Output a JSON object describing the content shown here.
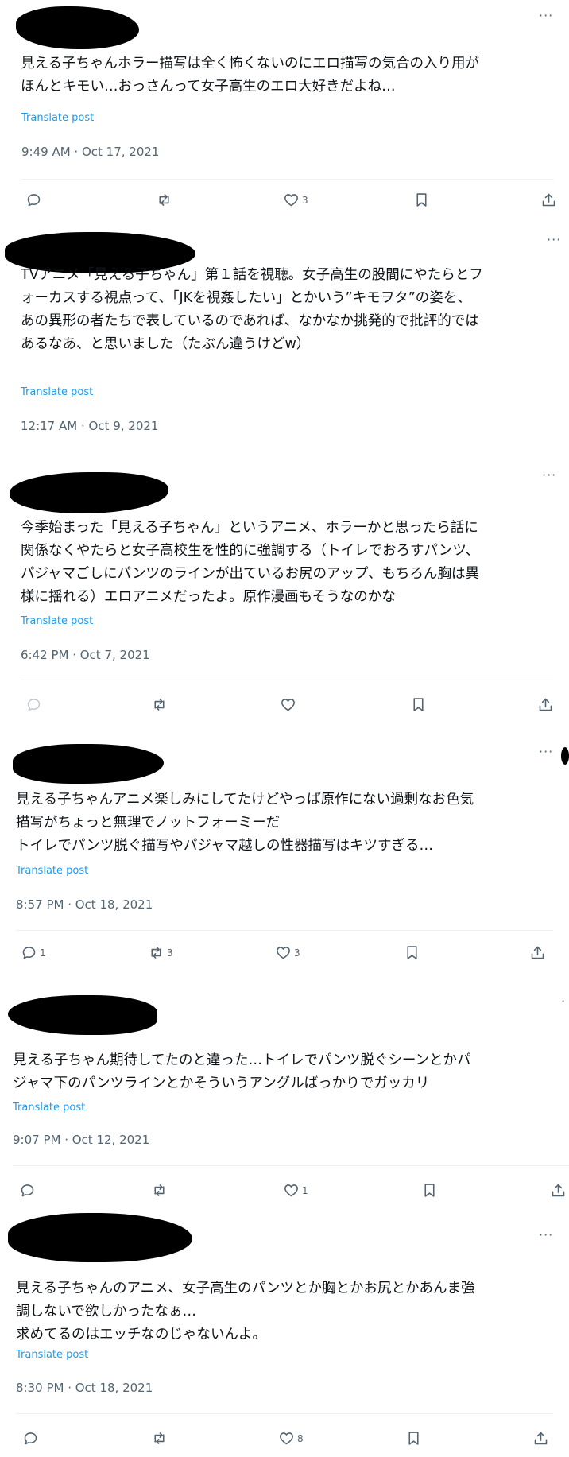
{
  "posts": [
    {
      "text": "見える子ちゃんホラー描写は全く怖くないのにエロ描写の気合の入り用が\nほんとキモい…おっさんって女子高生のエロ大好きだよね…",
      "translate": "Translate post",
      "time": "9:49 AM · Oct 17, 2021",
      "replies": "",
      "reposts": "",
      "likes": "3"
    },
    {
      "text": "TVアニメ「見える子ちゃん」第１話を視聴。女子高生の股間にやたらとフ\nォーカスする視点って、「JKを視姦したい」とかいう”キモヲタ”の姿を、\nあの異形の者たちで表しているのであれば、なかなか挑発的で批評的では\nあるなあ、と思いました（たぶん違うけどw）",
      "translate": "Translate post",
      "time": "12:17 AM · Oct 9, 2021"
    },
    {
      "text": "今季始まった「見える子ちゃん」というアニメ、ホラーかと思ったら話に\n関係なくやたらと女子高校生を性的に強調する（トイレでおろすパンツ、\nパジャマごしにパンツのラインが出ているお尻のアップ、もちろん胸は異\n様に揺れる）エロアニメだったよ。原作漫画もそうなのかな",
      "translate": "Translate post",
      "time": "6:42 PM · Oct 7, 2021",
      "replies": "",
      "reposts": "",
      "likes": ""
    },
    {
      "text": "見える子ちゃんアニメ楽しみにしてたけどやっぱ原作にない過剰なお色気\n描写がちょっと無理でノットフォーミーだ\nトイレでパンツ脱ぐ描写やパジャマ越しの性器描写はキツすぎる…",
      "translate": "Translate post",
      "time": "8:57 PM · Oct 18, 2021",
      "replies": "1",
      "reposts": "3",
      "likes": "3"
    },
    {
      "text": "見える子ちゃん期待してたのと違った…トイレでパンツ脱ぐシーンとかパ\nジャマ下のパンツラインとかそういうアングルばっかりでガッカリ",
      "translate": "Translate post",
      "time": "9:07 PM · Oct 12, 2021",
      "replies": "",
      "reposts": "",
      "likes": "1"
    },
    {
      "text": "見える子ちゃんのアニメ、女子高生のパンツとか胸とかお尻とかあんま強\n調しないで欲しかったなぁ…\n求めてるのはエッチなのじゃないんよ。",
      "translate": "Translate post",
      "time": "8:30 PM · Oct 18, 2021",
      "replies": "",
      "reposts": "",
      "likes": "8"
    }
  ],
  "icons": {
    "more": "more-icon",
    "reply": "reply-icon",
    "repost": "repost-icon",
    "like": "like-icon",
    "bookmark": "bookmark-icon",
    "share": "share-icon"
  }
}
